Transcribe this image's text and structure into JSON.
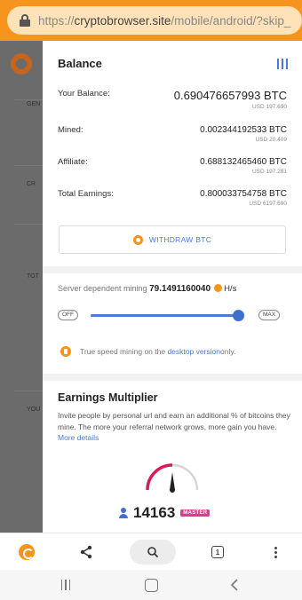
{
  "browser": {
    "url_prefix": "https://",
    "url_host": "cryptobrowser.site",
    "url_path": "/mobile/android/?skip_"
  },
  "background_page": {
    "tags": [
      "GEN",
      "CR",
      "TOT",
      "YOU"
    ]
  },
  "balance": {
    "header": "Balance",
    "rows": [
      {
        "label": "Your Balance:",
        "value": "0.690476657993 BTC",
        "usd": "USD 197.690"
      },
      {
        "label": "Mined:",
        "value": "0.002344192533 BTC",
        "usd": "USD 20.409"
      },
      {
        "label": "Affiliate:",
        "value": "0.688132465460 BTC",
        "usd": "USD 197.281"
      },
      {
        "label": "Total Earnings:",
        "value": "0.800033754758 BTC",
        "usd": "USD 6197.690"
      }
    ],
    "withdraw_label": "WITHDRAW BTC"
  },
  "mining": {
    "label": "Server dependent mining",
    "speed": "79.1491160040",
    "unit": "H/s",
    "off_label": "OFF",
    "max_label": "MAX",
    "slider_level": 0.97
  },
  "info": {
    "before": "True speed mining on the ",
    "link": "desktop version",
    "after": " only."
  },
  "multiplier": {
    "title": "Earnings Multiplier",
    "description": "Invite people by personal url and earn an additional % of bitcoins they mine. The more your referral network grows, more gain you have. ",
    "more_link": "More details",
    "count": "14163",
    "badge": "MASTER"
  },
  "colors": {
    "accent_orange": "#f7941d",
    "link_blue": "#4a7bd6",
    "badge_pink": "#e03a8c",
    "gauge_red": "#d81b5a"
  },
  "icons": {
    "bottom_bar": [
      "brave-logo-icon",
      "share-icon",
      "search-icon",
      "tabs-icon",
      "more-icon"
    ],
    "nav_bar": [
      "recents-icon",
      "home-icon",
      "back-icon"
    ]
  },
  "tabs_count": "1"
}
